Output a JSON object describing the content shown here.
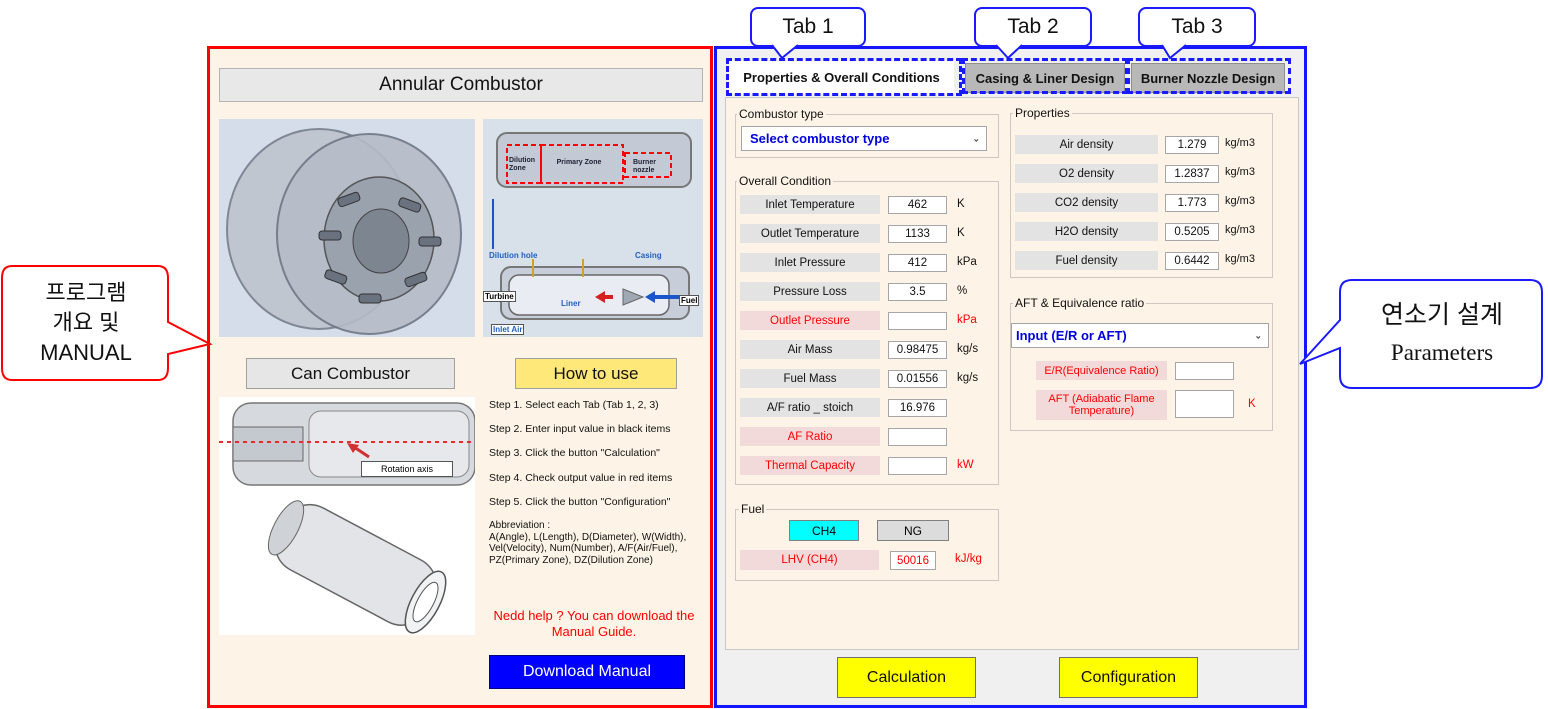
{
  "left": {
    "title": "Annular Combustor",
    "diagram_labels": {
      "dilution_zone": "Dilution Zone",
      "primary_zone": "Primary Zone",
      "burner_nozzle": "Burner nozzle",
      "dilution_hole": "Dilution hole",
      "casing": "Casing",
      "turbine": "Turbine",
      "liner": "Liner",
      "fuel": "Fuel",
      "inlet_air": "Inlet Air"
    },
    "rotation_axis": "Rotation axis",
    "can_combustor_label": "Can Combustor",
    "how_to_use_label": "How to use",
    "steps": [
      "Step 1. Select each Tab (Tab 1, 2, 3)",
      "Step 2. Enter input value in black items",
      "Step 3. Click the button \"Calculation\"",
      "Step 4. Check output value in red items",
      "Step 5. Click the button \"Configuration\""
    ],
    "abbreviation": "Abbreviation :\nA(Angle), L(Length), D(Diameter), W(Width), Vel(Velocity), Num(Number), A/F(Air/Fuel), PZ(Primary Zone), DZ(Dilution Zone)",
    "help": "Nedd help ? You can download the Manual Guide.",
    "download_label": "Download Manual"
  },
  "tabs": [
    "Properties & Overall Conditions",
    "Casing & Liner Design",
    "Burner Nozzle Design"
  ],
  "combustor_type": {
    "group": "Combustor type",
    "selected": "Select combustor type"
  },
  "overall": {
    "group": "Overall Condition",
    "rows": [
      {
        "label": "Inlet Temperature",
        "value": "462",
        "unit": "K"
      },
      {
        "label": "Outlet Temperature",
        "value": "1133",
        "unit": "K"
      },
      {
        "label": "Inlet Pressure",
        "value": "412",
        "unit": "kPa"
      },
      {
        "label": "Pressure Loss",
        "value": "3.5",
        "unit": "%"
      },
      {
        "label": "Outlet Pressure",
        "value": "",
        "unit": "kPa"
      },
      {
        "label": "Air Mass",
        "value": "0.98475",
        "unit": "kg/s"
      },
      {
        "label": "Fuel Mass",
        "value": "0.01556",
        "unit": "kg/s"
      },
      {
        "label": "A/F ratio _ stoich",
        "value": "16.976",
        "unit": ""
      },
      {
        "label": "AF Ratio",
        "value": "",
        "unit": ""
      },
      {
        "label": "Thermal Capacity",
        "value": "",
        "unit": "kW"
      }
    ]
  },
  "fuel": {
    "group": "Fuel",
    "ch4": "CH4",
    "ng": "NG",
    "lhv_label": "LHV (CH4)",
    "lhv_value": "50016",
    "lhv_unit": "kJ/kg"
  },
  "properties": {
    "group": "Properties",
    "rows": [
      {
        "label": "Air density",
        "value": "1.279",
        "unit": "kg/m3"
      },
      {
        "label": "O2 density",
        "value": "1.2837",
        "unit": "kg/m3"
      },
      {
        "label": "CO2 density",
        "value": "1.773",
        "unit": "kg/m3"
      },
      {
        "label": "H2O density",
        "value": "0.5205",
        "unit": "kg/m3"
      },
      {
        "label": "Fuel density",
        "value": "0.6442",
        "unit": "kg/m3"
      }
    ]
  },
  "aft": {
    "group": "AFT & Equivalence ratio",
    "selected": "Input (E/R or AFT)",
    "er_label": "E/R(Equivalence Ratio)",
    "aft_label": "AFT (Adiabatic Flame Temperature)",
    "aft_unit": "K"
  },
  "buttons": {
    "calculation": "Calculation",
    "configuration": "Configuration"
  },
  "annotations": {
    "tab1": "Tab 1",
    "tab2": "Tab 2",
    "tab3": "Tab 3",
    "left_callout": "프로그램\n개요 및\nMANUAL",
    "right_callout_1": "연소기 설계",
    "right_callout_2": "Parameters"
  },
  "colors": {
    "left_border": "#ff0000",
    "right_border": "#1414ff",
    "panel_bg": "#fdf4e7",
    "output_red": "#ff0000",
    "button_yellow": "#ffff00",
    "download_blue": "#0000ff",
    "ch4_cyan": "#00ffff"
  }
}
